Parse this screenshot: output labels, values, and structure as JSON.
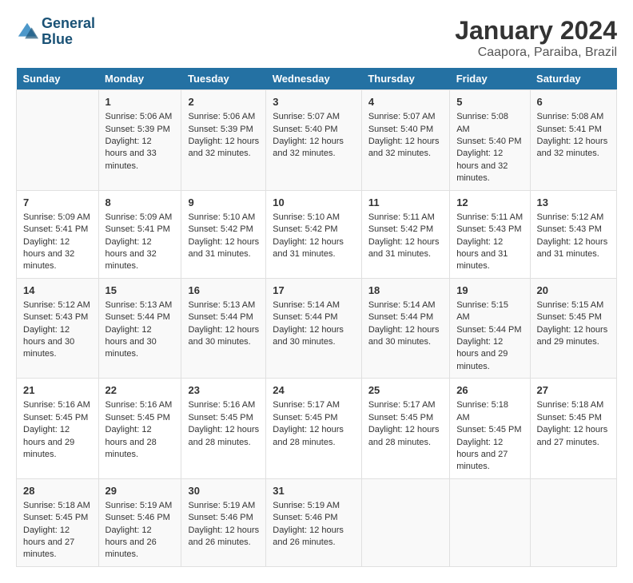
{
  "header": {
    "logo_line1": "General",
    "logo_line2": "Blue",
    "title": "January 2024",
    "subtitle": "Caapora, Paraiba, Brazil"
  },
  "weekdays": [
    "Sunday",
    "Monday",
    "Tuesday",
    "Wednesday",
    "Thursday",
    "Friday",
    "Saturday"
  ],
  "weeks": [
    [
      {
        "day": "",
        "sunrise": "",
        "sunset": "",
        "daylight": ""
      },
      {
        "day": "1",
        "sunrise": "Sunrise: 5:06 AM",
        "sunset": "Sunset: 5:39 PM",
        "daylight": "Daylight: 12 hours and 33 minutes."
      },
      {
        "day": "2",
        "sunrise": "Sunrise: 5:06 AM",
        "sunset": "Sunset: 5:39 PM",
        "daylight": "Daylight: 12 hours and 32 minutes."
      },
      {
        "day": "3",
        "sunrise": "Sunrise: 5:07 AM",
        "sunset": "Sunset: 5:40 PM",
        "daylight": "Daylight: 12 hours and 32 minutes."
      },
      {
        "day": "4",
        "sunrise": "Sunrise: 5:07 AM",
        "sunset": "Sunset: 5:40 PM",
        "daylight": "Daylight: 12 hours and 32 minutes."
      },
      {
        "day": "5",
        "sunrise": "Sunrise: 5:08 AM",
        "sunset": "Sunset: 5:40 PM",
        "daylight": "Daylight: 12 hours and 32 minutes."
      },
      {
        "day": "6",
        "sunrise": "Sunrise: 5:08 AM",
        "sunset": "Sunset: 5:41 PM",
        "daylight": "Daylight: 12 hours and 32 minutes."
      }
    ],
    [
      {
        "day": "7",
        "sunrise": "Sunrise: 5:09 AM",
        "sunset": "Sunset: 5:41 PM",
        "daylight": "Daylight: 12 hours and 32 minutes."
      },
      {
        "day": "8",
        "sunrise": "Sunrise: 5:09 AM",
        "sunset": "Sunset: 5:41 PM",
        "daylight": "Daylight: 12 hours and 32 minutes."
      },
      {
        "day": "9",
        "sunrise": "Sunrise: 5:10 AM",
        "sunset": "Sunset: 5:42 PM",
        "daylight": "Daylight: 12 hours and 31 minutes."
      },
      {
        "day": "10",
        "sunrise": "Sunrise: 5:10 AM",
        "sunset": "Sunset: 5:42 PM",
        "daylight": "Daylight: 12 hours and 31 minutes."
      },
      {
        "day": "11",
        "sunrise": "Sunrise: 5:11 AM",
        "sunset": "Sunset: 5:42 PM",
        "daylight": "Daylight: 12 hours and 31 minutes."
      },
      {
        "day": "12",
        "sunrise": "Sunrise: 5:11 AM",
        "sunset": "Sunset: 5:43 PM",
        "daylight": "Daylight: 12 hours and 31 minutes."
      },
      {
        "day": "13",
        "sunrise": "Sunrise: 5:12 AM",
        "sunset": "Sunset: 5:43 PM",
        "daylight": "Daylight: 12 hours and 31 minutes."
      }
    ],
    [
      {
        "day": "14",
        "sunrise": "Sunrise: 5:12 AM",
        "sunset": "Sunset: 5:43 PM",
        "daylight": "Daylight: 12 hours and 30 minutes."
      },
      {
        "day": "15",
        "sunrise": "Sunrise: 5:13 AM",
        "sunset": "Sunset: 5:44 PM",
        "daylight": "Daylight: 12 hours and 30 minutes."
      },
      {
        "day": "16",
        "sunrise": "Sunrise: 5:13 AM",
        "sunset": "Sunset: 5:44 PM",
        "daylight": "Daylight: 12 hours and 30 minutes."
      },
      {
        "day": "17",
        "sunrise": "Sunrise: 5:14 AM",
        "sunset": "Sunset: 5:44 PM",
        "daylight": "Daylight: 12 hours and 30 minutes."
      },
      {
        "day": "18",
        "sunrise": "Sunrise: 5:14 AM",
        "sunset": "Sunset: 5:44 PM",
        "daylight": "Daylight: 12 hours and 30 minutes."
      },
      {
        "day": "19",
        "sunrise": "Sunrise: 5:15 AM",
        "sunset": "Sunset: 5:44 PM",
        "daylight": "Daylight: 12 hours and 29 minutes."
      },
      {
        "day": "20",
        "sunrise": "Sunrise: 5:15 AM",
        "sunset": "Sunset: 5:45 PM",
        "daylight": "Daylight: 12 hours and 29 minutes."
      }
    ],
    [
      {
        "day": "21",
        "sunrise": "Sunrise: 5:16 AM",
        "sunset": "Sunset: 5:45 PM",
        "daylight": "Daylight: 12 hours and 29 minutes."
      },
      {
        "day": "22",
        "sunrise": "Sunrise: 5:16 AM",
        "sunset": "Sunset: 5:45 PM",
        "daylight": "Daylight: 12 hours and 28 minutes."
      },
      {
        "day": "23",
        "sunrise": "Sunrise: 5:16 AM",
        "sunset": "Sunset: 5:45 PM",
        "daylight": "Daylight: 12 hours and 28 minutes."
      },
      {
        "day": "24",
        "sunrise": "Sunrise: 5:17 AM",
        "sunset": "Sunset: 5:45 PM",
        "daylight": "Daylight: 12 hours and 28 minutes."
      },
      {
        "day": "25",
        "sunrise": "Sunrise: 5:17 AM",
        "sunset": "Sunset: 5:45 PM",
        "daylight": "Daylight: 12 hours and 28 minutes."
      },
      {
        "day": "26",
        "sunrise": "Sunrise: 5:18 AM",
        "sunset": "Sunset: 5:45 PM",
        "daylight": "Daylight: 12 hours and 27 minutes."
      },
      {
        "day": "27",
        "sunrise": "Sunrise: 5:18 AM",
        "sunset": "Sunset: 5:45 PM",
        "daylight": "Daylight: 12 hours and 27 minutes."
      }
    ],
    [
      {
        "day": "28",
        "sunrise": "Sunrise: 5:18 AM",
        "sunset": "Sunset: 5:45 PM",
        "daylight": "Daylight: 12 hours and 27 minutes."
      },
      {
        "day": "29",
        "sunrise": "Sunrise: 5:19 AM",
        "sunset": "Sunset: 5:46 PM",
        "daylight": "Daylight: 12 hours and 26 minutes."
      },
      {
        "day": "30",
        "sunrise": "Sunrise: 5:19 AM",
        "sunset": "Sunset: 5:46 PM",
        "daylight": "Daylight: 12 hours and 26 minutes."
      },
      {
        "day": "31",
        "sunrise": "Sunrise: 5:19 AM",
        "sunset": "Sunset: 5:46 PM",
        "daylight": "Daylight: 12 hours and 26 minutes."
      },
      {
        "day": "",
        "sunrise": "",
        "sunset": "",
        "daylight": ""
      },
      {
        "day": "",
        "sunrise": "",
        "sunset": "",
        "daylight": ""
      },
      {
        "day": "",
        "sunrise": "",
        "sunset": "",
        "daylight": ""
      }
    ]
  ]
}
